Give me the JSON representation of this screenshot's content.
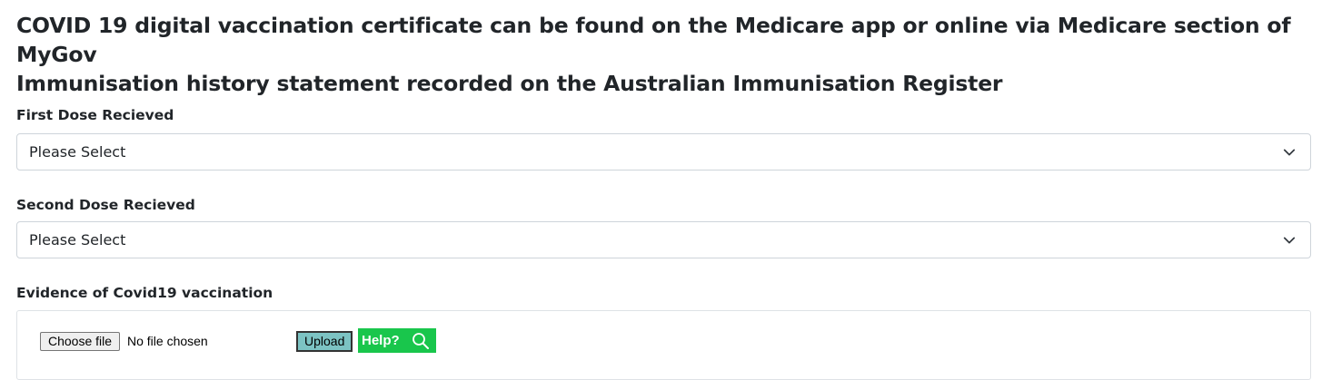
{
  "heading": {
    "line1": "COVID 19 digital vaccination certificate can be found on the Medicare app or online via Medicare section of MyGov",
    "line2": "Immunisation history statement recorded on the Australian Immunisation Register"
  },
  "first_dose": {
    "label": "First Dose Recieved",
    "selected": "Please Select"
  },
  "second_dose": {
    "label": "Second Dose Recieved",
    "selected": "Please Select"
  },
  "evidence": {
    "label": "Evidence of Covid19 vaccination",
    "choose_file_label": "Choose file",
    "no_file_text": "No file chosen",
    "upload_label": "Upload",
    "help_label": "Help?",
    "help_icon": "magnifier-icon"
  },
  "colors": {
    "upload_button": "#7cc3c3",
    "help_button": "#19c64c",
    "text": "#212529"
  }
}
